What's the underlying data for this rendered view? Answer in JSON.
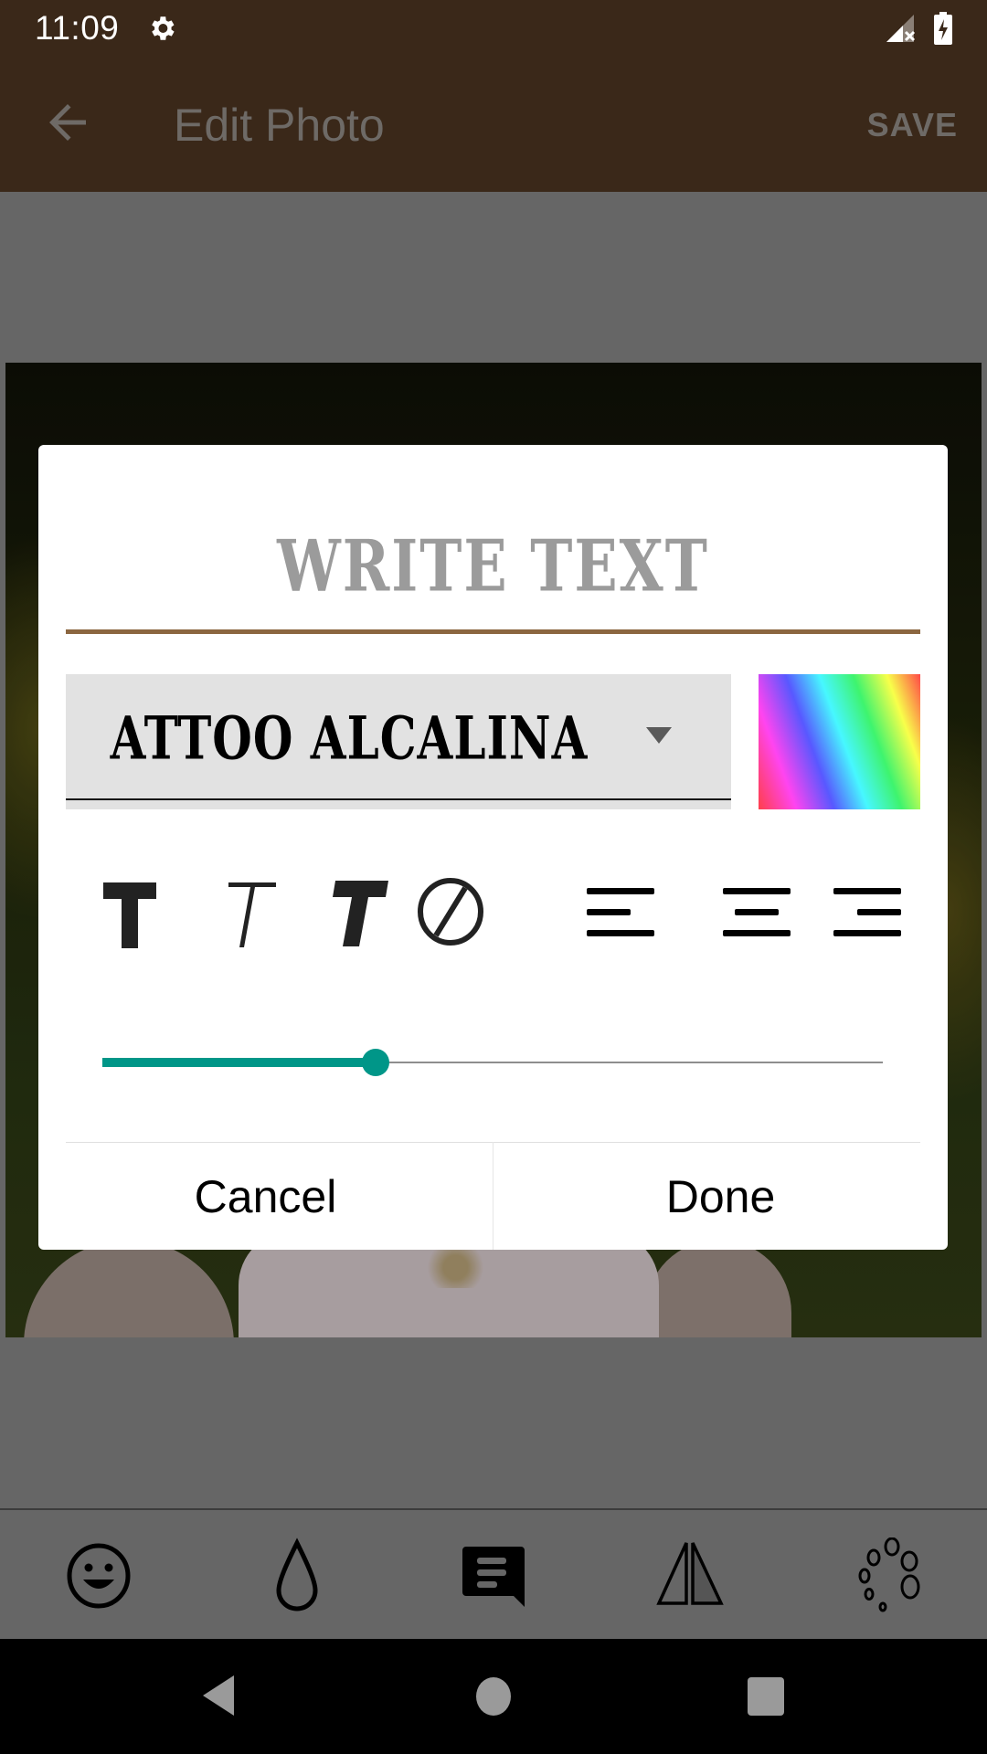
{
  "status_bar": {
    "time": "11:09",
    "icons": [
      "settings-gear-icon",
      "signal-no-data-icon",
      "battery-charging-icon"
    ]
  },
  "app_bar": {
    "back_icon": "arrow-back-icon",
    "title": "Edit Photo",
    "save_label": "SAVE"
  },
  "dialog": {
    "title_placeholder": "WRITE TEXT",
    "font_select": {
      "selected": "ATTOO ALCALINA",
      "dropdown_icon": "triangle-down-icon"
    },
    "color_picker_icon": "rainbow-gradient-swatch",
    "style_buttons": [
      {
        "name": "text-bold",
        "icon": "bold-t-icon"
      },
      {
        "name": "text-italic",
        "icon": "italic-t-icon"
      },
      {
        "name": "text-bold-italic",
        "icon": "bold-italic-t-icon"
      },
      {
        "name": "text-no-style",
        "icon": "none-slash-icon"
      },
      {
        "name": "align-left",
        "icon": "align-left-icon"
      },
      {
        "name": "align-center",
        "icon": "align-center-icon"
      },
      {
        "name": "align-right",
        "icon": "align-right-icon"
      }
    ],
    "size_slider": {
      "value": 0.35,
      "accent": "#009688"
    },
    "cancel_label": "Cancel",
    "done_label": "Done"
  },
  "bottom_toolbar": {
    "tools": [
      {
        "name": "sticker",
        "icon": "smiley-icon"
      },
      {
        "name": "blur",
        "icon": "drop-icon"
      },
      {
        "name": "text",
        "icon": "text-message-icon"
      },
      {
        "name": "mirror",
        "icon": "mirror-triangle-icon"
      },
      {
        "name": "effects",
        "icon": "circles-icon"
      }
    ]
  },
  "nav_bar": {
    "back": "nav-back-icon",
    "home": "nav-home-icon",
    "recents": "nav-recents-icon"
  },
  "colors": {
    "app_bar": "#3a2819",
    "title_underline": "#8b6640",
    "accent": "#009688",
    "overlay": "#666666"
  }
}
